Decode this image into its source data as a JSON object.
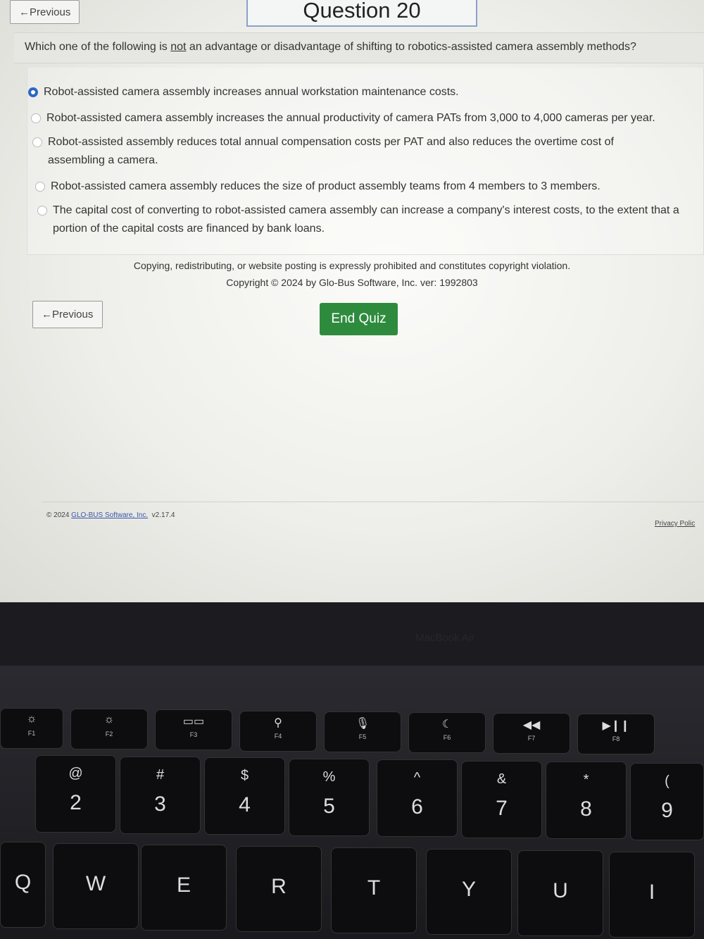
{
  "header": {
    "previous_label": "←Previous",
    "question_title": "Question 20"
  },
  "question": {
    "pre": "Which one of the following is ",
    "emph": "not",
    "post": " an advantage or disadvantage of shifting to robotics-assisted camera assembly methods?"
  },
  "options": [
    {
      "text": "Robot-assisted camera assembly increases annual workstation maintenance costs.",
      "selected": true
    },
    {
      "text": "Robot-assisted camera assembly increases the annual productivity of camera PATs from 3,000 to 4,000 cameras per year.",
      "selected": false
    },
    {
      "text": "Robot-assisted assembly reduces total annual compensation costs per PAT and also reduces the overtime cost of assembling a camera.",
      "selected": false
    },
    {
      "text": "Robot-assisted camera assembly reduces the size of product assembly teams from 4 members to 3 members.",
      "selected": false
    },
    {
      "text": "The capital cost of converting to robot-assisted camera assembly can increase a company's interest costs, to the extent that a portion of the capital costs are financed by bank loans.",
      "selected": false
    }
  ],
  "notice": {
    "line1": "Copying, redistributing, or website posting is expressly prohibited and constitutes copyright violation.",
    "line2": "Copyright © 2024 by Glo-Bus Software, Inc. ver: 1992803"
  },
  "actions": {
    "previous_label": "←Previous",
    "end_quiz_label": "End Quiz",
    "end_quiz_color": "#2e8b3e"
  },
  "footer": {
    "copyright": "© 2024 ",
    "company_link": "GLO-BUS Software, Inc.",
    "version": "v2.17.4",
    "privacy": "Privacy Polic"
  },
  "laptop": {
    "brand": "MacBook Air",
    "function_keys": [
      {
        "icon": "☼",
        "label": "F1"
      },
      {
        "icon": "☼",
        "label": "F2"
      },
      {
        "icon": "▭▭",
        "label": "F3"
      },
      {
        "icon": "⚲",
        "label": "F4"
      },
      {
        "icon": "🎙",
        "label": "F5"
      },
      {
        "icon": "☾",
        "label": "F6"
      },
      {
        "icon": "◀◀",
        "label": "F7"
      },
      {
        "icon": "▶❙❙",
        "label": "F8"
      }
    ],
    "number_keys": [
      {
        "shift": "@",
        "main": "2"
      },
      {
        "shift": "#",
        "main": "3"
      },
      {
        "shift": "$",
        "main": "4"
      },
      {
        "shift": "%",
        "main": "5"
      },
      {
        "shift": "^",
        "main": "6"
      },
      {
        "shift": "&",
        "main": "7"
      },
      {
        "shift": "*",
        "main": "8"
      },
      {
        "shift": "(",
        "main": "9"
      }
    ],
    "letter_keys": [
      "Q",
      "W",
      "E",
      "R",
      "T",
      "Y",
      "U",
      "I"
    ]
  }
}
